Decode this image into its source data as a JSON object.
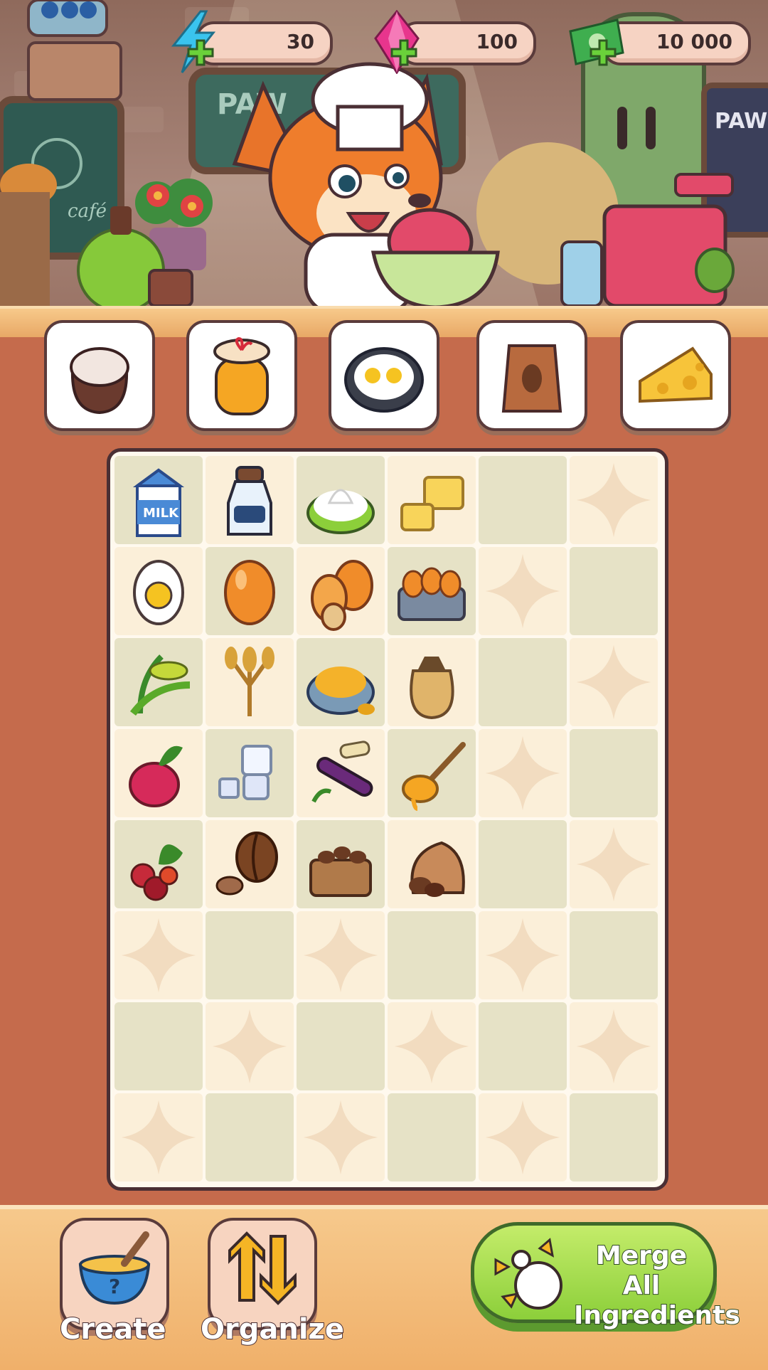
{
  "resources": {
    "energy": {
      "value": "30",
      "icon": "lightning-icon",
      "color": "#3ac4ee"
    },
    "gems": {
      "value": "100",
      "icon": "gem-icon",
      "color": "#e8358d"
    },
    "money": {
      "value": "10 000",
      "icon": "cash-icon",
      "color": "#3fae4f"
    }
  },
  "scene": {
    "chalkboard_left_text": "café",
    "sign_center_text": "PAW",
    "sign_right_text": "PAW"
  },
  "order_slots": [
    {
      "item": "flour-sack"
    },
    {
      "item": "honey-jar"
    },
    {
      "item": "fried-eggs-pan"
    },
    {
      "item": "coffee-bag"
    },
    {
      "item": "cheese-wedge"
    }
  ],
  "board": {
    "columns": 6,
    "rows": 8,
    "items": [
      [
        "milk-carton",
        "milk-bottle",
        "cream-bowl",
        "butter-blocks",
        null,
        null
      ],
      [
        "boiled-egg",
        "egg",
        "eggs-pair",
        "egg-tray",
        null,
        null
      ],
      [
        "wheat-sprout",
        "wheat-bundle",
        "grain-bowl",
        "flour-sack",
        null,
        null
      ],
      [
        "beetroot",
        "sugar-cubes",
        "sugar-cane",
        "honey-dipper",
        null,
        null
      ],
      [
        "coffee-cherries",
        "coffee-bean",
        "coffee-beans-box",
        "coffee-beans-sack",
        null,
        null
      ],
      [
        null,
        null,
        null,
        null,
        null,
        null
      ],
      [
        null,
        null,
        null,
        null,
        null,
        null
      ],
      [
        null,
        null,
        null,
        null,
        null,
        null
      ]
    ],
    "milk_label": "MILK"
  },
  "buttons": {
    "create": "Create",
    "organize": "Organize",
    "merge": "Merge All Ingredients"
  }
}
